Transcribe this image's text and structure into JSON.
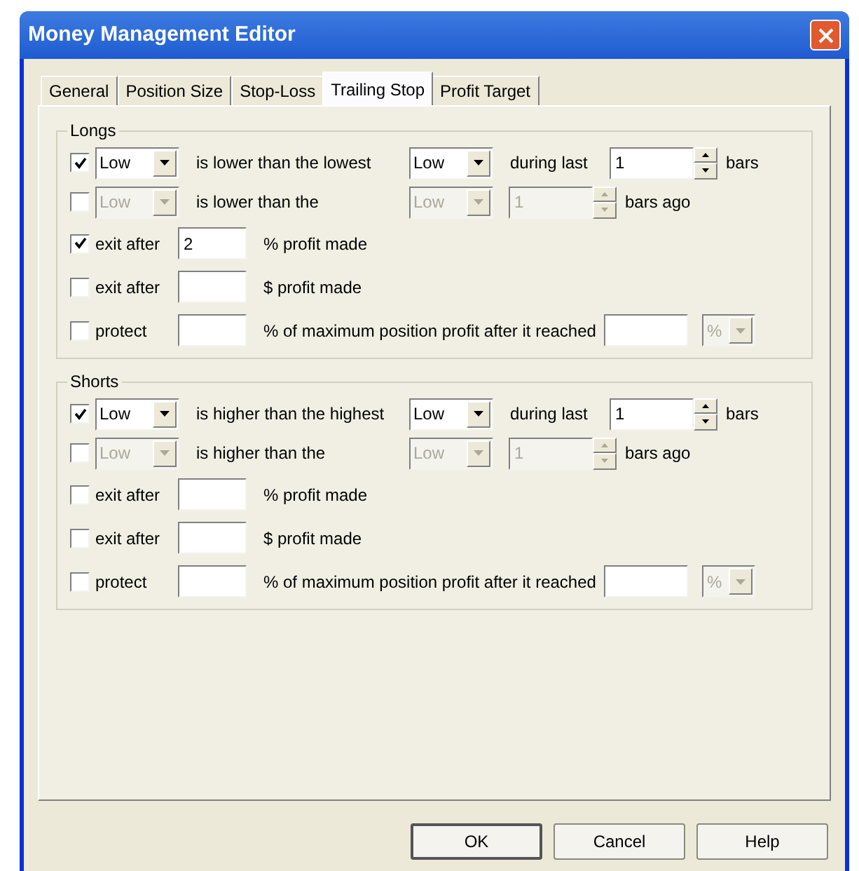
{
  "window": {
    "title": "Money Management Editor"
  },
  "tabs": [
    {
      "label": "General",
      "selected": false
    },
    {
      "label": "Position Size",
      "selected": false
    },
    {
      "label": "Stop-Loss",
      "selected": false
    },
    {
      "label": "Trailing Stop",
      "selected": true
    },
    {
      "label": "Profit Target",
      "selected": false
    }
  ],
  "groups": [
    {
      "title": "Longs",
      "rows": [
        {
          "kind": "compare",
          "checked": true,
          "disabled": false,
          "source": "Low",
          "text": "is lower than the lowest",
          "target": "Low",
          "middle": "during last",
          "count": "1",
          "unit": "bars"
        },
        {
          "kind": "compare",
          "checked": false,
          "disabled": true,
          "source": "Low",
          "text": "is lower than the",
          "target": "Low",
          "count": "1",
          "unit": "bars ago"
        },
        {
          "kind": "amount",
          "checked": true,
          "label": "exit after",
          "value": "2",
          "text": "% profit made"
        },
        {
          "kind": "amount",
          "checked": false,
          "label": "exit after",
          "text": "$ profit made"
        },
        {
          "kind": "protect",
          "checked": false,
          "label": "protect",
          "text": "% of maximum position profit after it reached",
          "unit": "%"
        }
      ]
    },
    {
      "title": "Shorts",
      "rows": [
        {
          "kind": "compare",
          "checked": true,
          "disabled": false,
          "source": "Low",
          "text": "is higher than the highest",
          "target": "Low",
          "middle": "during last",
          "count": "1",
          "unit": "bars"
        },
        {
          "kind": "compare",
          "checked": false,
          "disabled": true,
          "source": "Low",
          "text": "is higher than the",
          "target": "Low",
          "count": "1",
          "unit": "bars ago"
        },
        {
          "kind": "amount",
          "checked": false,
          "label": "exit after",
          "text": "% profit made"
        },
        {
          "kind": "amount",
          "checked": false,
          "label": "exit after",
          "text": "$ profit made"
        },
        {
          "kind": "protect",
          "checked": false,
          "label": "protect",
          "text": "% of maximum position profit after it reached",
          "unit": "%"
        }
      ]
    }
  ],
  "buttons": [
    {
      "label": "OK",
      "default": true
    },
    {
      "label": "Cancel",
      "default": false
    },
    {
      "label": "Help",
      "default": false
    }
  ]
}
